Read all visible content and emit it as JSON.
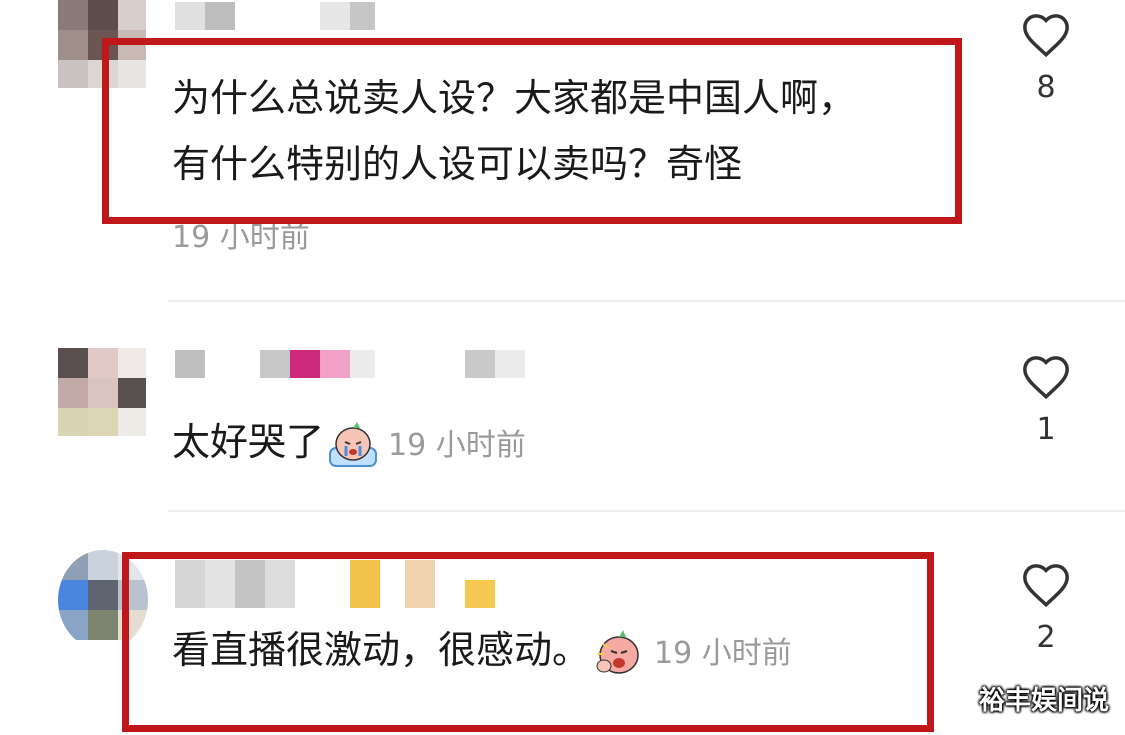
{
  "comments": [
    {
      "text_line1": "为什么总说卖人设？大家都是中国人啊，",
      "text_line2": "有什么特别的人设可以卖吗？奇怪",
      "time": "19 小时前",
      "likes": "8",
      "highlighted": true
    },
    {
      "text": "太好哭了",
      "emoji": "crying-face-emoji",
      "time": "19 小时前",
      "likes": "1",
      "highlighted": false
    },
    {
      "text": "看直播很激动，很感动。",
      "emoji": "excited-face-emoji",
      "time": "19 小时前",
      "likes": "2",
      "highlighted": true
    }
  ],
  "watermark": "裕丰娱间说",
  "colors": {
    "highlight": "#c0171b",
    "muted": "#9a9a9a",
    "divider": "#eeeeee"
  },
  "icons": {
    "like": "heart-outline-icon"
  }
}
